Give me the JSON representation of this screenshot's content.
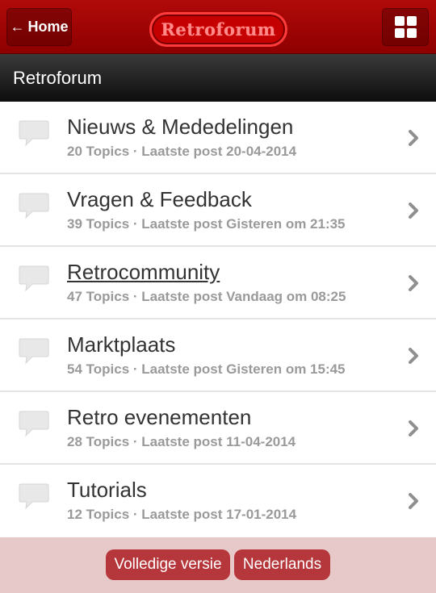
{
  "header": {
    "home_label": "Home",
    "home_arrow": "←",
    "logo_text": "Retroforum",
    "menu_icon": "grid-icon"
  },
  "page_title": "Retroforum",
  "forums": [
    {
      "title": "Nieuws & Mededelingen",
      "meta": "20 Topics · Laatste post 20-04-2014",
      "underlined": false
    },
    {
      "title": "Vragen & Feedback",
      "meta": "39 Topics · Laatste post Gisteren om 21:35",
      "underlined": false
    },
    {
      "title": "Retrocommunity",
      "meta": "47 Topics · Laatste post Vandaag om 08:25",
      "underlined": true
    },
    {
      "title": "Marktplaats",
      "meta": "54 Topics · Laatste post Gisteren om 15:45",
      "underlined": false
    },
    {
      "title": "Retro evenementen",
      "meta": "28 Topics · Laatste post 11-04-2014",
      "underlined": false
    },
    {
      "title": "Tutorials",
      "meta": "12 Topics · Laatste post 17-01-2014",
      "underlined": false
    }
  ],
  "footer": {
    "full_version_label": "Volledige versie",
    "language_label": "Nederlands"
  },
  "colors": {
    "brand_red": "#a00000",
    "footer_button": "#b5373b",
    "footer_bg": "#e7c9c9"
  }
}
